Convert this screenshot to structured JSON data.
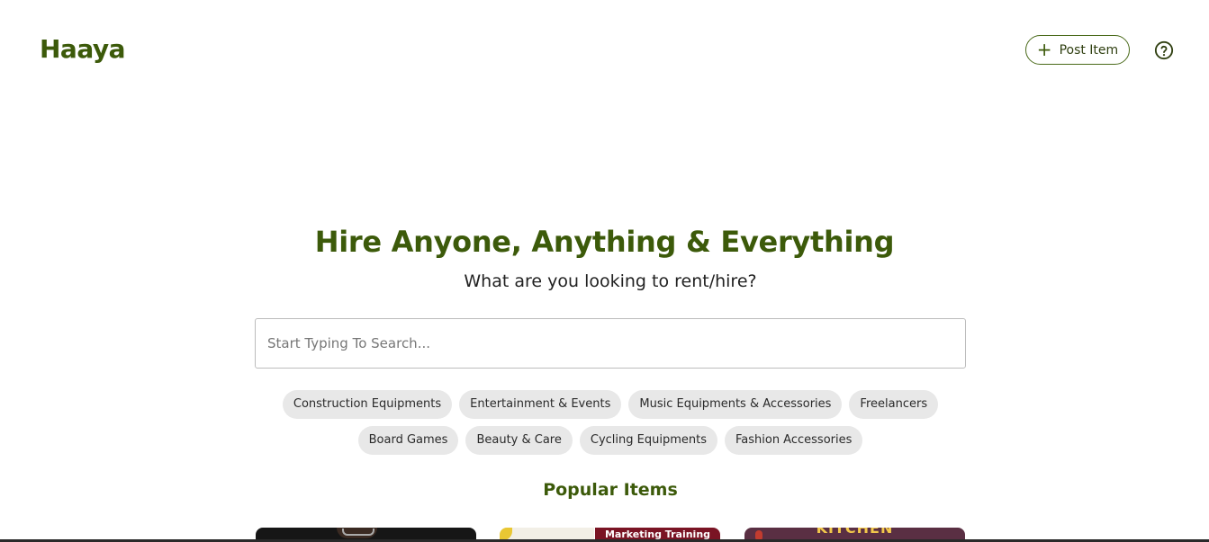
{
  "header": {
    "logo": "Haaya",
    "post_button_label": "Post Item",
    "post_button_icon": "plus-icon",
    "help_icon": "help-circle-icon"
  },
  "hero": {
    "title": "Hire Anyone, Anything & Everything",
    "subtitle": "What are you looking to rent/hire?"
  },
  "search": {
    "placeholder": "Start Typing To Search...",
    "value": ""
  },
  "categories": [
    "Construction Equipments",
    "Entertainment & Events",
    "Music Equipments & Accessories",
    "Freelancers",
    "Board Games",
    "Beauty & Care",
    "Cycling Equipments",
    "Fashion Accessories"
  ],
  "popular": {
    "title": "Popular Items",
    "cards": [
      {
        "text": ""
      },
      {
        "text": "Marketing Training"
      },
      {
        "text": "KITCHEN"
      }
    ]
  },
  "colors": {
    "brand": "#3c5a0a",
    "chip_bg": "#e8e8e8",
    "border": "#bcbcbc"
  }
}
